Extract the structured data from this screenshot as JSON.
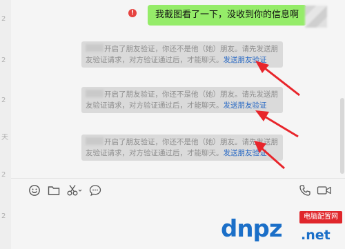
{
  "left_numbers": [
    "2",
    "2",
    "2",
    "天",
    "2",
    "2"
  ],
  "outgoing_message": {
    "text": "我截图看了一下，没收到你的信息啊",
    "status_icon": "!",
    "bubble_color": "#95ec69"
  },
  "system_notices": [
    {
      "prefix": "开启了朋友验证，你还不是他（她）朋友。请先发送朋友验证请求，对方验证通过后，才能聊天。",
      "link": "发送朋友验证"
    },
    {
      "prefix": "开启了朋友验证，你还不是他（她）朋友。请先发送朋友验证请求，对方验证通过后，才能聊天。",
      "link": "发送朋友验证"
    },
    {
      "prefix": "开启了朋友验证，你还不是他（她）朋友。请先发送朋友验证请求，对方验证通过后，才能聊天。",
      "link": "发送朋友验证"
    }
  ],
  "toolbar": {
    "left_icons": [
      "emoji-icon",
      "folder-icon",
      "scissors-icon",
      "chat-bubble-icon"
    ],
    "right_icons": [
      "phone-icon",
      "video-icon"
    ]
  },
  "watermark": {
    "brand": "dnpz",
    "tld": ".net",
    "badge": "电脑配置网"
  },
  "colors": {
    "accent_link": "#2a6ac4",
    "arrow_red": "#e8252b",
    "error_red": "#e64340"
  }
}
